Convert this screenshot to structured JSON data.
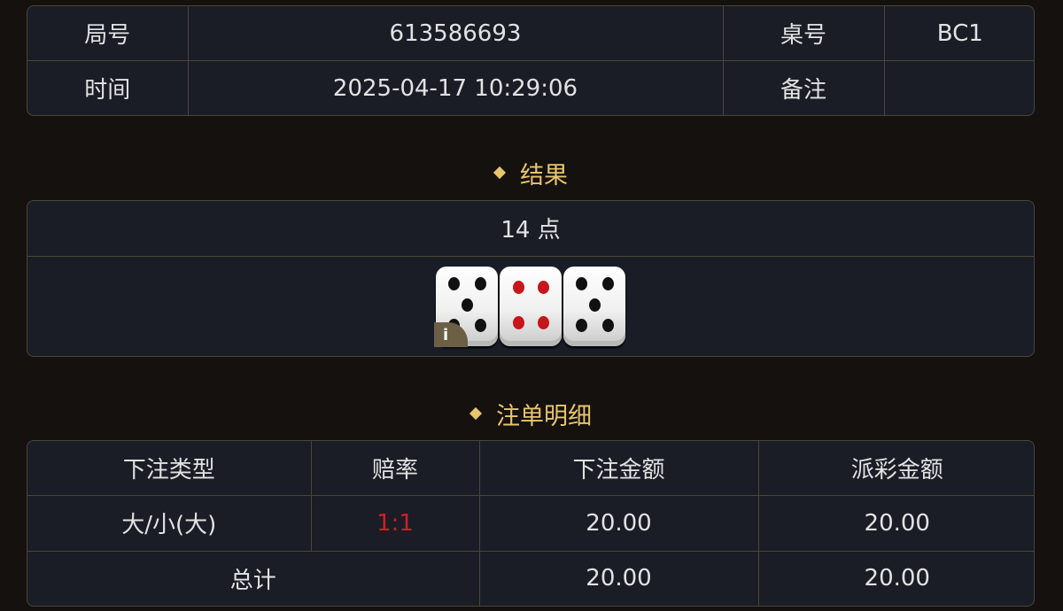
{
  "info": {
    "round_label": "局号",
    "round_value": "613586693",
    "table_label": "桌号",
    "table_value": "BC1",
    "time_label": "时间",
    "time_value": "2025-04-17 10:29:06",
    "note_label": "备注",
    "note_value": ""
  },
  "result": {
    "title": "结果",
    "points": "14 点",
    "dice": [
      5,
      4,
      5
    ],
    "info_icon_text": "i"
  },
  "bets": {
    "title": "注单明细",
    "headers": [
      "下注类型",
      "赔率",
      "下注金额",
      "派彩金额"
    ],
    "rows": [
      {
        "type": "大/小(大)",
        "odds": "1:1",
        "amount": "20.00",
        "payout": "20.00"
      }
    ],
    "total_label": "总计",
    "total_amount": "20.00",
    "total_payout": "20.00"
  },
  "colors": {
    "accent": "#e8c46c",
    "odds_red": "#d21e24",
    "border": "#4b4536",
    "panel": "#1a1d26"
  }
}
